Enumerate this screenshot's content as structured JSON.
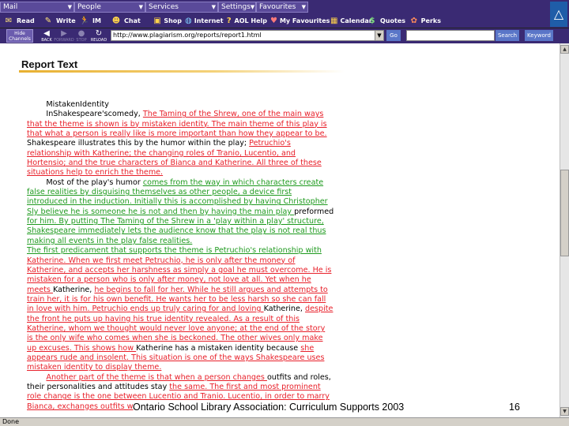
{
  "menus": [
    {
      "label": "Mail"
    },
    {
      "label": "People"
    },
    {
      "label": "Services"
    },
    {
      "label": "Settings"
    },
    {
      "label": "Favourites"
    }
  ],
  "toolbar": [
    {
      "label": "Read",
      "icon": "envelope-icon"
    },
    {
      "label": "Write",
      "icon": "pencil-icon"
    },
    {
      "label": "IM",
      "icon": "running-man-icon"
    },
    {
      "label": "Chat",
      "icon": "chat-people-icon"
    },
    {
      "label": "Shop",
      "icon": "shopping-bag-icon"
    },
    {
      "label": "Internet",
      "icon": "globe-icon"
    },
    {
      "label": "AOL Help",
      "icon": "question-icon"
    },
    {
      "label": "My Favourites",
      "icon": "heart-icon"
    },
    {
      "label": "Calendar",
      "icon": "calendar-icon"
    },
    {
      "label": "Quotes",
      "icon": "dollar-icon"
    },
    {
      "label": "Perks",
      "icon": "gift-icon"
    }
  ],
  "nav": {
    "hide_channels": "Hide Channels",
    "back": "BACK",
    "forward": "FORWARD",
    "stop": "STOP",
    "reload": "RELOAD",
    "url": "http://www.plagiarism.org/reports/report1.html",
    "go": "Go",
    "search": "Search",
    "keyword": "Keyword"
  },
  "report": {
    "title": "Report Text",
    "lines": [
      [
        {
          "t": "    MistakenIdentity",
          "s": "n"
        }
      ],
      [
        {
          "t": "    InShakespeare'scomedy, ",
          "s": "n"
        },
        {
          "t": "The Taming of the Shrew, one of the main ways",
          "s": "r"
        }
      ],
      [
        {
          "t": "that the theme is shown is by mistaken identity. The main theme of this play is",
          "s": "r"
        }
      ],
      [
        {
          "t": "that what a person is really like is more important than how they appear to be.",
          "s": "r"
        }
      ],
      [
        {
          "t": "Shakespeare illustrates this by the humor within the play; ",
          "s": "n"
        },
        {
          "t": "Petruchio's",
          "s": "r"
        }
      ],
      [
        {
          "t": "relationship with Katherine; the changing roles of Tranio, Lucentio, and",
          "s": "r"
        }
      ],
      [
        {
          "t": "Hortensio; and the true characters of Bianca and Katherine. All three of these",
          "s": "r"
        }
      ],
      [
        {
          "t": "situations help to enrich the theme.",
          "s": "r"
        }
      ],
      [
        {
          "t": "    Most of the play's humor ",
          "s": "n"
        },
        {
          "t": "comes from the way in which characters create",
          "s": "g"
        }
      ],
      [
        {
          "t": "false realities by disguising themselves as other people, a device first",
          "s": "g"
        }
      ],
      [
        {
          "t": "introduced in the induction. Initially this is accomplished by having Christopher",
          "s": "g"
        }
      ],
      [
        {
          "t": "Sly believe he is someone he is not and then by having the main play ",
          "s": "g"
        },
        {
          "t": "preformed",
          "s": "n"
        }
      ],
      [
        {
          "t": "for him. By putting The Taming of the Shrew in a 'play within a play' structure,",
          "s": "g"
        }
      ],
      [
        {
          "t": "Shakespeare immediately lets the audience know that the play is not real thus",
          "s": "g"
        }
      ],
      [
        {
          "t": "making all events in the play false realities.",
          "s": "g"
        }
      ],
      [
        {
          "t": "The first predicament that supports the theme is Petruchio's relationship with",
          "s": "g"
        }
      ],
      [
        {
          "t": "Katherine. When we first meet Petruchio, he is only after the money of",
          "s": "r"
        }
      ],
      [
        {
          "t": "Katherine, and accepts her harshness as simply a goal he must overcome. He is",
          "s": "r"
        }
      ],
      [
        {
          "t": "mistaken for a person who is only after money, not love at all. Yet when he",
          "s": "r"
        }
      ],
      [
        {
          "t": "meets ",
          "s": "r"
        },
        {
          "t": "Katherine, ",
          "s": "n"
        },
        {
          "t": "he begins to fall for her. While he still argues and attempts to",
          "s": "r"
        }
      ],
      [
        {
          "t": "train her, it is for his own benefit. He wants her to be less harsh so she can fall",
          "s": "r"
        }
      ],
      [
        {
          "t": "in love with him. Petruchio ends up truly caring for and loving ",
          "s": "r"
        },
        {
          "t": "Katherine, ",
          "s": "n"
        },
        {
          "t": "despite",
          "s": "r"
        }
      ],
      [
        {
          "t": "the front he puts up having his true identity revealed. As a result of this",
          "s": "r"
        }
      ],
      [
        {
          "t": "Katherine, whom we thought would never love anyone; at the end of the story",
          "s": "r"
        }
      ],
      [
        {
          "t": "is the only wife who comes when she is beckoned. The other wives only make",
          "s": "r"
        }
      ],
      [
        {
          "t": "up excuses. This shows how ",
          "s": "r"
        },
        {
          "t": "Katherine has a mistaken identity because ",
          "s": "n"
        },
        {
          "t": "she",
          "s": "r"
        }
      ],
      [
        {
          "t": "appears rude and insolent. This situation is one of the ways Shakespeare uses",
          "s": "r"
        }
      ],
      [
        {
          "t": "mistaken identity to display theme.",
          "s": "r"
        }
      ],
      [
        {
          "t": "    ",
          "s": "n"
        },
        {
          "t": "Another part of the theme is that when a person changes ",
          "s": "r"
        },
        {
          "t": "outfits and roles,",
          "s": "n"
        }
      ],
      [
        {
          "t": "their personalities and attitudes stay ",
          "s": "n"
        },
        {
          "t": "the same. The first and most prominent",
          "s": "r"
        }
      ],
      [
        {
          "t": "role change is the one between Lucentio and Tranio. Lucentio, in order to marry",
          "s": "r"
        }
      ],
      [
        {
          "t": "Bianca, exchanges outfits w",
          "s": "r"
        }
      ]
    ]
  },
  "footer": {
    "caption": "Ontario School Library Association: Curriculum Supports 2003",
    "page": "16"
  },
  "status": "Done"
}
